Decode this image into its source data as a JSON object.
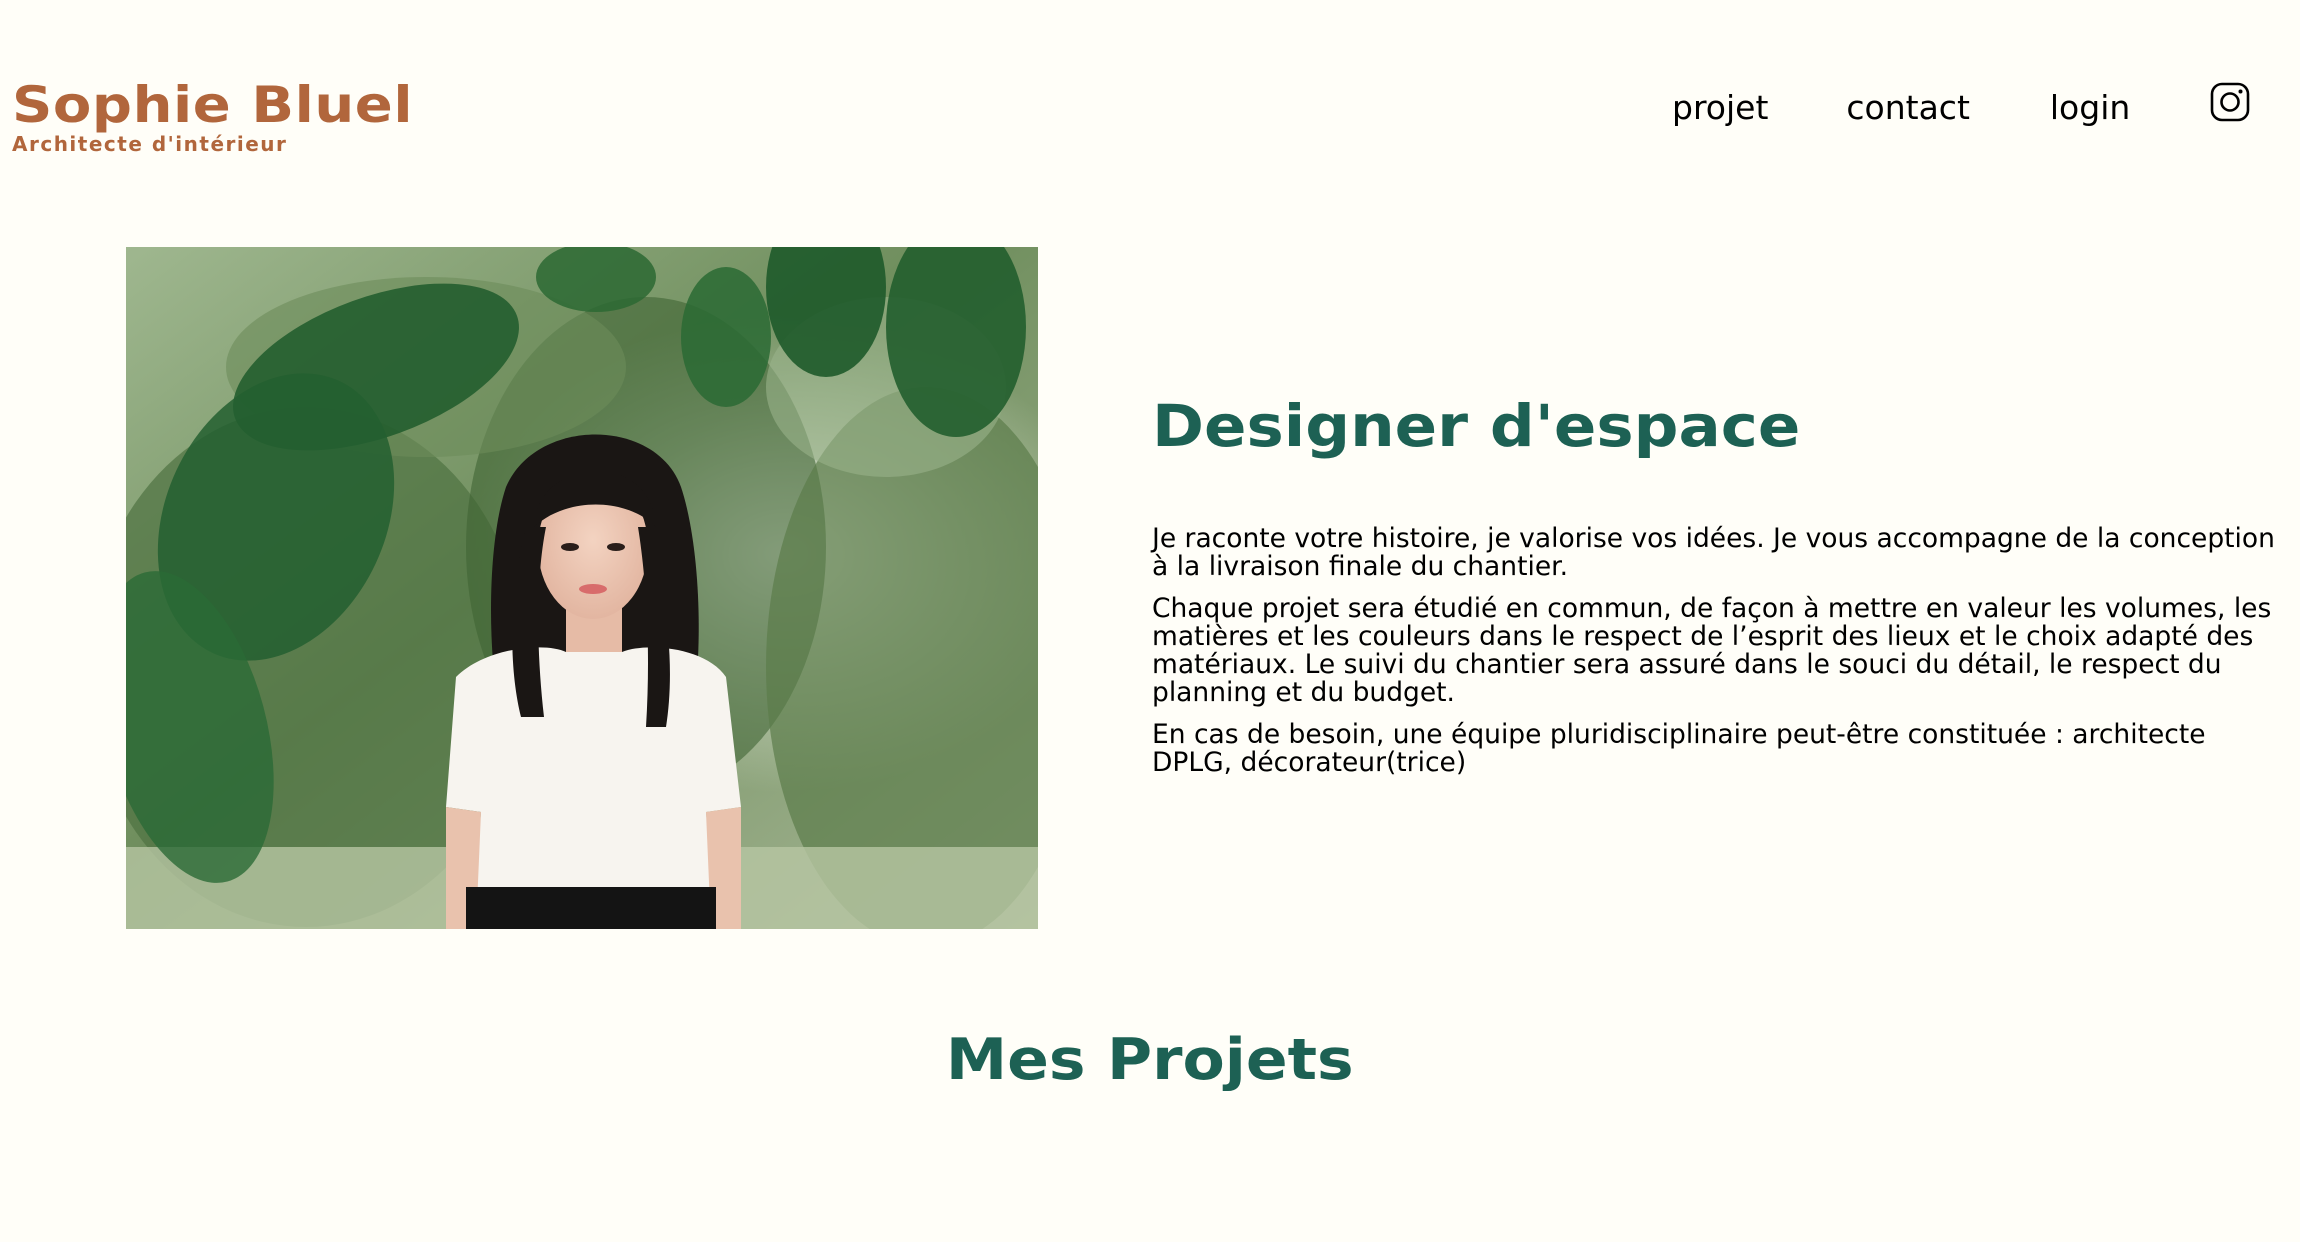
{
  "header": {
    "logo_title": "Sophie Bluel",
    "logo_subtitle": "Architecte d'intérieur",
    "nav": {
      "projet": "projet",
      "contact": "contact",
      "login": "login"
    },
    "instagram_icon": "instagram-icon"
  },
  "intro": {
    "heading": "Designer d'espace",
    "paragraphs": [
      "Je raconte votre histoire, je valorise vos idées. Je vous accompagne de la conception à la livraison finale du chantier.",
      "Chaque projet sera étudié en commun, de façon à mettre en valeur les volumes, les matières et les couleurs dans le respect de l’esprit des lieux et le choix adapté des matériaux. Le suivi du chantier sera assuré dans le souci du détail, le respect du planning et du budget.",
      "En cas de besoin, une équipe pluridisciplinaire peut-être constituée : architecte DPLG, décorateur(trice)"
    ]
  },
  "projects": {
    "heading": "Mes Projets"
  },
  "colors": {
    "brand": "#B1663C",
    "accent": "#1D6154",
    "background": "#FFFEF8"
  }
}
